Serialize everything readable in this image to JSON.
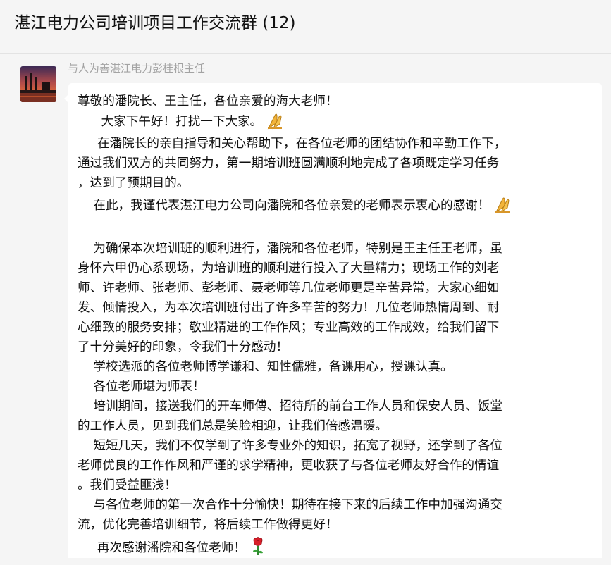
{
  "window": {
    "title": "湛江电力公司培训项目工作交流群 (12)"
  },
  "message": {
    "sender_name": "与人为善湛江电力彭桂根主任",
    "lines": [
      "尊敬的潘院长、王主任，各位亲爱的海大老师！",
      "      大家下午好！打扰一下大家。",
      "     在潘院长的亲自指导和关心帮助下，在各位老师的团结协作和辛勤工作下，",
      "通过我们双方的共同努力，第一期培训班圆满顺利地完成了各项既定学习任务",
      "，达到了预期目的。",
      "    在此，我谨代表湛江电力公司向潘院和各位亲爱的老师表示衷心的感谢！",
      "",
      "    为确保本次培训班的顺利进行，潘院和各位老师，特别是王主任王老师，虽",
      "身怀六甲仍心系现场，为培训班的顺利进行投入了大量精力；现场工作的刘老",
      "师、许老师、张老师、彭老师、聂老师等几位老师更是辛苦异常，大家心细如",
      "发、倾情投入，为本次培训班付出了许多辛苦的努力！几位老师热情周到、耐",
      "心细致的服务安排；敬业精进的工作作风；专业高效的工作成效，给我们留下",
      "了十分美好的印象，令我们十分感动！",
      "    学校选派的各位老师博学谦和、知性儒雅，备课用心，授课认真。",
      "    各位老师堪为师表！",
      "    培训期间，接送我们的开车师傅、招待所的前台工作人员和保安人员、饭堂",
      "的工作人员，见到我们总是笑脸相迎，让我们倍感温暖。",
      "    短短几天，我们不仅学到了许多专业外的知识，拓宽了视野，还学到了各位",
      "老师优良的工作作风和严谨的求学精神，更收获了与各位老师友好合作的情谊",
      "。我们受益匪浅！",
      "    与各位老师的第一次合作十分愉快！期待在接下来的后续工作中加强沟通交",
      "流，优化完善培训细节，将后续工作做得更好！",
      "     再次感谢潘院和各位老师！"
    ]
  },
  "icons": {
    "avatar": "avatar-image",
    "pray": "pray-hands-icon",
    "rose": "rose-icon"
  }
}
